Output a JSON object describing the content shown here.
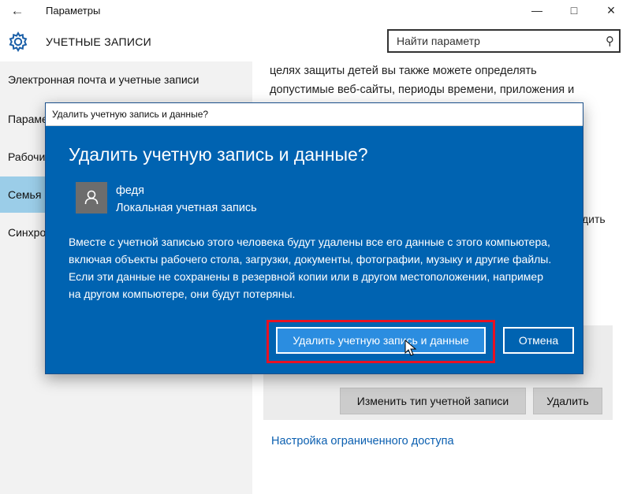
{
  "window": {
    "back_icon": "back-arrow-icon",
    "title": "Параметры",
    "minimize_icon": "minimize-icon",
    "maximize_icon": "maximize-icon",
    "close_icon": "close-icon"
  },
  "header": {
    "icon": "gear-icon",
    "title": "УЧЕТНЫЕ ЗАПИСИ",
    "search_placeholder": "Найти параметр",
    "search_icon": "search-icon"
  },
  "sidebar": {
    "items": [
      {
        "label": "Электронная почта и учетные записи",
        "active": false
      },
      {
        "label": "Параметры входа",
        "active": false
      },
      {
        "label": "Рабочий доступ",
        "active": false
      },
      {
        "label": "Семья и другие пользователи",
        "active": true
      },
      {
        "label": "Синхронизация ваших параметров",
        "active": false
      }
    ],
    "active_color": "#9bcde8"
  },
  "content": {
    "paragraph_lines": [
      "целях защиты детей вы также можете определять",
      "допустимые веб-сайты, периоды времени, приложения и"
    ],
    "partial_text": "дить",
    "change_type_button": "Изменить тип учетной записи",
    "delete_button": "Удалить",
    "restricted_access_link": "Настройка ограниченного доступа"
  },
  "dialog": {
    "window_title": "Удалить учетную запись и данные?",
    "heading": "Удалить учетную запись и данные?",
    "avatar_icon": "user-avatar-icon",
    "account_name": "федя",
    "account_type": "Локальная учетная запись",
    "warning_text": "Вместе с учетной записью этого человека будут удалены все его данные с этого компьютера, включая объекты рабочего стола, загрузки, документы, фотографии, музыку и другие файлы. Если эти данные не сохранены в резервной копии или в другом местоположении, например на другом компьютере, они будут потеряны.",
    "confirm_button": "Удалить учетную запись и данные",
    "cancel_button": "Отмена",
    "background_color": "#0063b1",
    "highlight_color": "#e81123"
  }
}
